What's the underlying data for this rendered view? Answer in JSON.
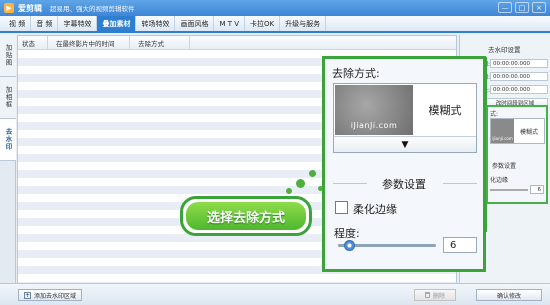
{
  "window": {
    "app_name": "爱剪辑",
    "slogan": "超易用、强大的视频剪辑软件",
    "controls": [
      "—",
      "□",
      "×"
    ]
  },
  "menu_tabs": [
    {
      "label": "视 频",
      "active": false
    },
    {
      "label": "音 频",
      "active": false
    },
    {
      "label": "字幕特效",
      "active": false
    },
    {
      "label": "叠加素材",
      "active": true
    },
    {
      "label": "转场特效",
      "active": false
    },
    {
      "label": "画面风格",
      "active": false
    },
    {
      "label": "M T V",
      "active": false
    },
    {
      "label": "卡拉OK",
      "active": false
    },
    {
      "label": "升级与服务",
      "active": false
    }
  ],
  "side_tabs": [
    {
      "label": "加贴图",
      "active": false
    },
    {
      "label": "加相框",
      "active": false
    },
    {
      "label": "去水印",
      "active": true
    }
  ],
  "list": {
    "columns": [
      "状态",
      "在最终影片中的时间",
      "去除方式"
    ]
  },
  "right_panel": {
    "section_title": "去水印设置",
    "rows": [
      {
        "label": "间:",
        "value": "00:00:00.000"
      },
      {
        "label": "间:",
        "value": "00:00:00.000"
      },
      {
        "label": "长:",
        "value": "00:00:00.000"
      }
    ],
    "range_button": "改时间段到区域",
    "mini_label": "式:",
    "mini_preview": "iJianJi.com",
    "mini_mode": "模糊式",
    "mini_params": "参数设置",
    "mini_soft": "化边缘",
    "mini_value": "6"
  },
  "zoom_panel": {
    "method_label": "去除方式:",
    "preview_text": "iJianJi.com",
    "mode_text": "模糊式",
    "dropdown_arrow": "▼",
    "params_title": "参数设置",
    "soften_label": "柔化边缘",
    "soften_checked": false,
    "degree_label": "程度:",
    "degree_value": "6",
    "degree_fraction": 0.1
  },
  "callout": {
    "text": "选择去除方式"
  },
  "bottom": {
    "add_button": "添加去水印区域",
    "add_icon": "+",
    "delete_button": "删除",
    "confirm_button": "确认修改"
  },
  "colors": {
    "accent": "#2f7fd0",
    "callout_green": "#3aa43a"
  }
}
